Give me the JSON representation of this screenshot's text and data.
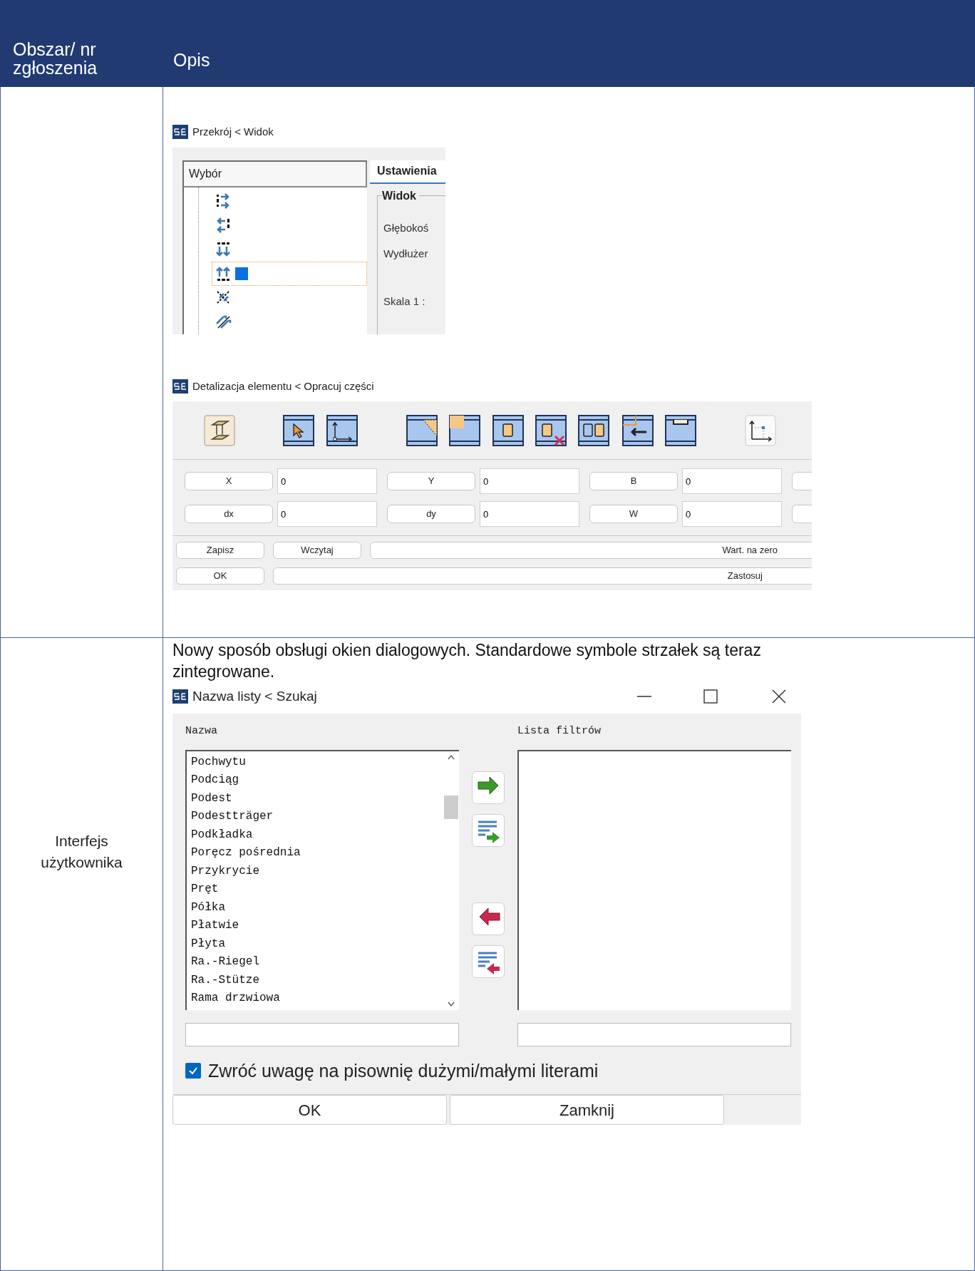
{
  "table": {
    "columns": [
      "Obszar/ nr zgłoszenia",
      "Opis"
    ]
  },
  "rows": [
    {
      "dialogs": [
        {
          "kind": "tree",
          "title": "Przekrój < Widok",
          "list_header": "Wybór",
          "tree_items": [
            {
              "selected": false
            },
            {
              "selected": false
            },
            {
              "selected": false
            },
            {
              "selected": true
            },
            {
              "selected": false
            },
            {
              "selected": false
            }
          ],
          "tab": "Ustawienia",
          "group": "Widok",
          "labels": [
            "Głębokoś",
            "Wydłużer",
            "Skala 1 :"
          ]
        },
        {
          "kind": "toolbar",
          "title": "Detalizacja elementu < Opracuj części",
          "fields": [
            [
              {
                "label": "X",
                "value": "0"
              },
              {
                "label": "Y",
                "value": "0"
              },
              {
                "label": "B",
                "value": "0"
              }
            ],
            [
              {
                "label": "dx",
                "value": "0"
              },
              {
                "label": "dy",
                "value": "0"
              },
              {
                "label": "W",
                "value": "0"
              }
            ]
          ],
          "button_rows": [
            [
              "Zapisz",
              "Wczytaj",
              "Wart. na zero"
            ],
            [
              "OK",
              "Zastosuj"
            ]
          ]
        }
      ]
    },
    {
      "area": "Interfejs użytkownika",
      "description": "Nowy sposób obsługi okien dialogowych. Standardowe symbole strzałek są teraz zintegrowane.",
      "dialog": {
        "title": "Nazwa listy < Szukaj",
        "left_label": "Nazwa",
        "right_label": "Lista filtrów",
        "items": [
          "Pochwytu",
          "Podciąg",
          "Podest",
          "Podestträger",
          "Podkładka",
          "Poręcz pośrednia",
          "Przykrycie",
          "Pręt",
          "Półka",
          "Płatwie",
          "Płyta",
          "Ra.-Riegel",
          "Ra.-Stütze",
          "Rama drzwiowa"
        ],
        "checkbox": {
          "label": "Zwróć uwagę na pisownię dużymi/małymi literami",
          "checked": true
        },
        "buttons": [
          "OK",
          "Zamknij"
        ]
      }
    }
  ]
}
